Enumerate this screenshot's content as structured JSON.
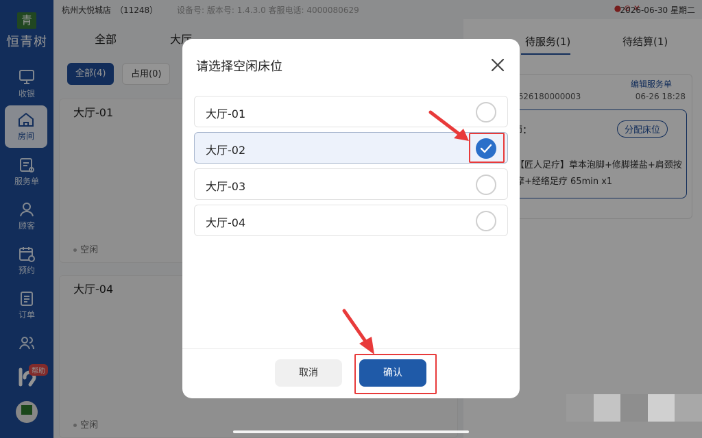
{
  "app": {
    "name": "恒青树",
    "logo_char": "青"
  },
  "topbar": {
    "store": "杭州大悦城店　（11248）",
    "meta": "设备号:  版本号:  1.4.3.0  客服电话:  4000080629",
    "datetime": "2026-06-30 星期二"
  },
  "sidebar": {
    "items": [
      {
        "label": "收银",
        "icon": "cashier-icon"
      },
      {
        "label": "房间",
        "icon": "home-icon"
      },
      {
        "label": "服务单",
        "icon": "service-order-icon"
      },
      {
        "label": "顾客",
        "icon": "customer-icon"
      },
      {
        "label": "预约",
        "icon": "calendar-icon"
      },
      {
        "label": "订单",
        "icon": "order-icon"
      }
    ],
    "help_badge": "帮助"
  },
  "main": {
    "tabs": [
      "全部",
      "大厅"
    ],
    "filters": [
      "全部(4)",
      "占用(0)"
    ],
    "cards": [
      {
        "title": "大厅-01",
        "status": "空闲"
      },
      {
        "title": "大厅-04",
        "status": "空闲"
      }
    ]
  },
  "right": {
    "tabs": [
      "待服务(1)",
      "待结算(1)"
    ],
    "edit_label": "编辑服务单",
    "order_no": "0626180000003",
    "order_time": "06-26 18:28",
    "tech_label": "师：",
    "assign_label": "分配床位",
    "service": "【匠人足疗】草本泡脚+修脚搓盐+肩颈按摩+经络足疗 65min x1"
  },
  "modal": {
    "title": "请选择空闲床位",
    "options": [
      {
        "label": "大厅-01",
        "selected": false
      },
      {
        "label": "大厅-02",
        "selected": true
      },
      {
        "label": "大厅-03",
        "selected": false
      },
      {
        "label": "大厅-04",
        "selected": false
      }
    ],
    "cancel_label": "取消",
    "confirm_label": "确认"
  },
  "colors": {
    "brand": "#1f4f9b",
    "accent_check": "#2a6fc9",
    "annotation": "#e83a3a"
  }
}
